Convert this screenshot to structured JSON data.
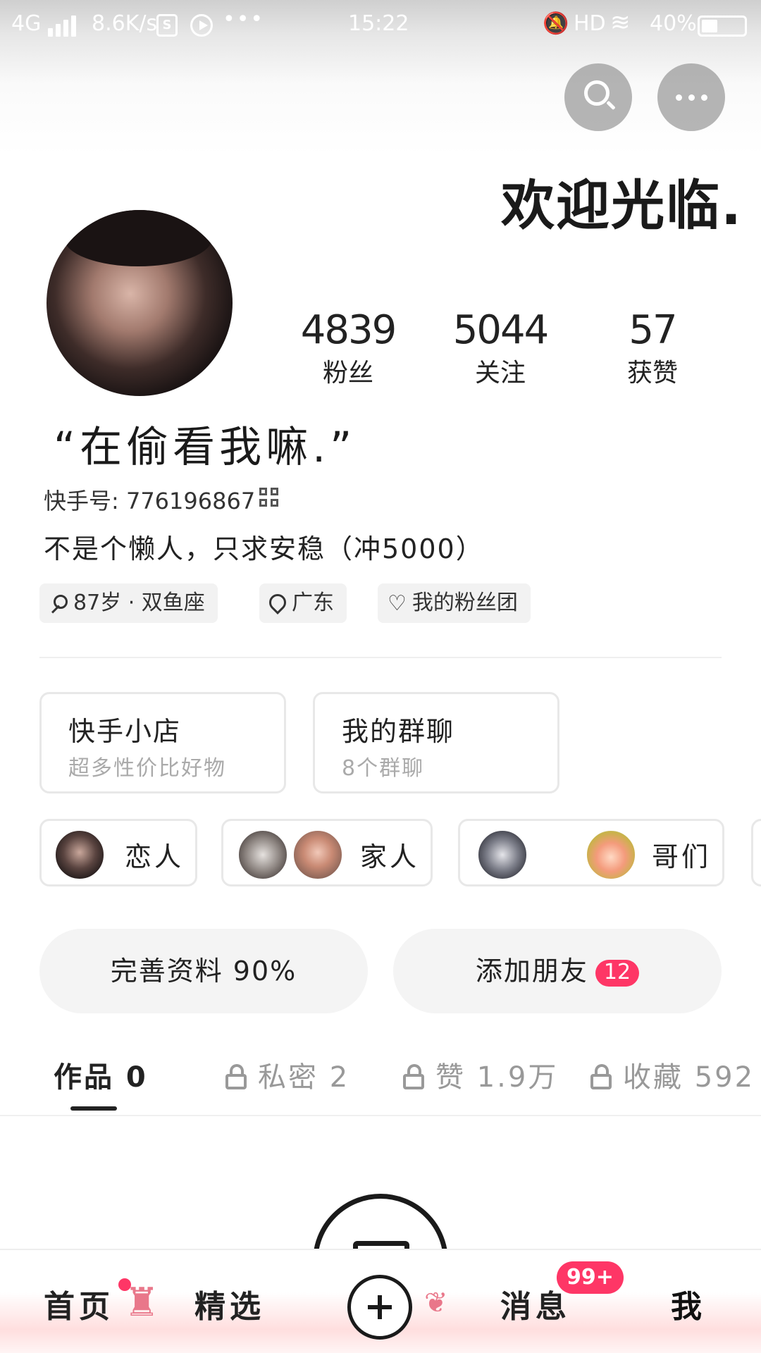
{
  "status_bar": {
    "network": "4G",
    "speed": "8.6K/s",
    "time": "15:22",
    "hd": "HD",
    "battery": "40%",
    "s_icon": "S"
  },
  "header": {
    "welcome_text": "欢迎光临."
  },
  "profile": {
    "nickname": "“在偷看我嘛.”",
    "kuaishou_id": "快手号: 776196867",
    "bio": "不是个懒人，只求安稳（冲5000）",
    "stats": [
      {
        "value": "4839",
        "label": "粉丝"
      },
      {
        "value": "5044",
        "label": "关注"
      },
      {
        "value": "57",
        "label": "获赞"
      }
    ],
    "tags": {
      "age": "87岁 · 双鱼座",
      "location": "广东",
      "fan_group": "我的粉丝团"
    }
  },
  "cards": [
    {
      "title": "快手小店",
      "subtitle": "超多性价比好物"
    },
    {
      "title": "我的群聊",
      "subtitle": "8个群聊"
    }
  ],
  "relations": [
    {
      "label": "恋人"
    },
    {
      "label": "家人"
    },
    {
      "label": "哥们"
    }
  ],
  "actions": {
    "complete_profile": "完善资料 90%",
    "add_friends": "添加朋友",
    "add_friends_badge": "12"
  },
  "tabs": [
    {
      "label": "作品 0"
    },
    {
      "label": "私密 2"
    },
    {
      "label": "赞 1.9万"
    },
    {
      "label": "收藏 592"
    }
  ],
  "bottom_nav": {
    "home": "首页",
    "featured": "精选",
    "messages": "消息",
    "messages_badge": "99+",
    "me": "我"
  },
  "colors": {
    "accent": "#fe3666",
    "text": "#222222",
    "muted": "#999999"
  }
}
